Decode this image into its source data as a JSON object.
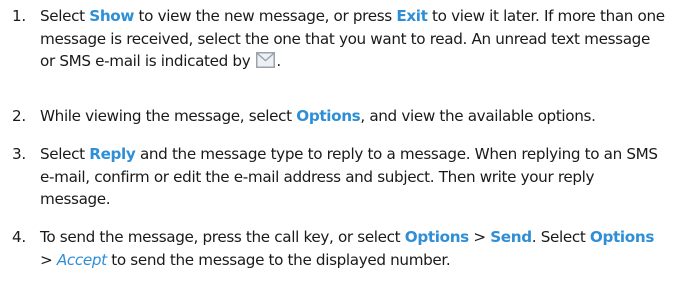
{
  "steps": [
    {
      "num": "1.",
      "parts": [
        {
          "t": "Select "
        },
        {
          "k": "Show"
        },
        {
          "t": " to view the new message, or press "
        },
        {
          "k": "Exit"
        },
        {
          "t": " to view it later. If more than one message is received, select the one that you want to read. An unread text message or SMS e-mail is indicated by"
        },
        {
          "icon": "unread-message-icon"
        },
        {
          "t": "."
        }
      ]
    },
    {
      "num": "2.",
      "parts": [
        {
          "t": "While viewing the message, select "
        },
        {
          "k": "Options"
        },
        {
          "t": ", and view the available options."
        }
      ]
    },
    {
      "num": "3.",
      "parts": [
        {
          "t": "Select "
        },
        {
          "k": "Reply"
        },
        {
          "t": " and the message type to reply to a message. When replying to an SMS e-mail, confirm or edit the e-mail address and subject. Then write your reply message."
        }
      ]
    },
    {
      "num": "4.",
      "parts": [
        {
          "t": "To send the message, press the call key, or select "
        },
        {
          "k": "Options"
        },
        {
          "t": " > "
        },
        {
          "k": "Send"
        },
        {
          "t": ". Select "
        },
        {
          "k": "Options"
        },
        {
          "t": " > "
        },
        {
          "ki": "Accept"
        },
        {
          "t": " to send the message to the displayed number."
        }
      ]
    }
  ],
  "colors": {
    "text": "#1a1a1a",
    "keyword": "#2f8fd6",
    "icon_stroke": "#9aa3ad",
    "icon_fill": "#eef1f4"
  }
}
